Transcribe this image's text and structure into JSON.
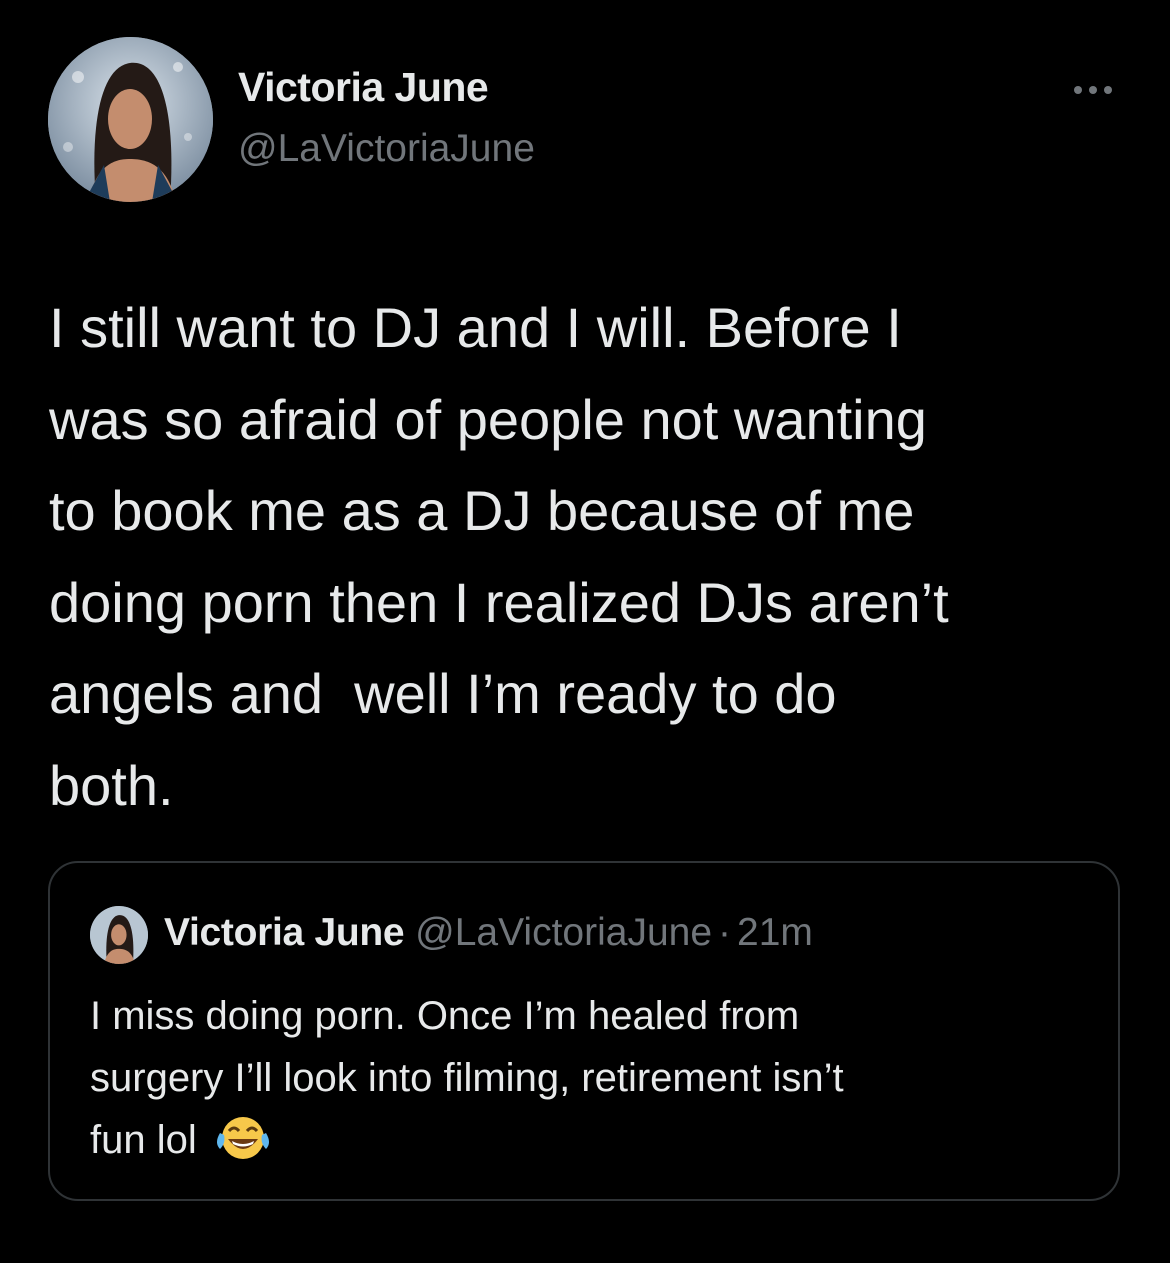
{
  "tweet": {
    "author": {
      "name": "Victoria June",
      "handle": "@LaVictoriaJune"
    },
    "more_icon": "more-horizontal-icon",
    "text_lines": [
      "I still want to DJ and I will. Before I",
      "was so afraid of people not wanting",
      "to book me as a DJ because of me",
      "doing porn then I realized DJs aren’t",
      "angels and  well I’m ready to do",
      "both."
    ]
  },
  "quote": {
    "author": {
      "name": "Victoria June",
      "handle": "@LaVictoriaJune",
      "separator": "·",
      "time": "21m"
    },
    "text_lines": [
      "I miss doing porn. Once I’m healed from",
      "surgery I’ll look into filming, retirement isn’t",
      "fun lol"
    ],
    "emoji": "face-with-tears-of-joy-icon"
  },
  "colors": {
    "background": "#000000",
    "primary_text": "#e7e9ea",
    "secondary_text": "#71767b",
    "border": "#2f3336"
  }
}
